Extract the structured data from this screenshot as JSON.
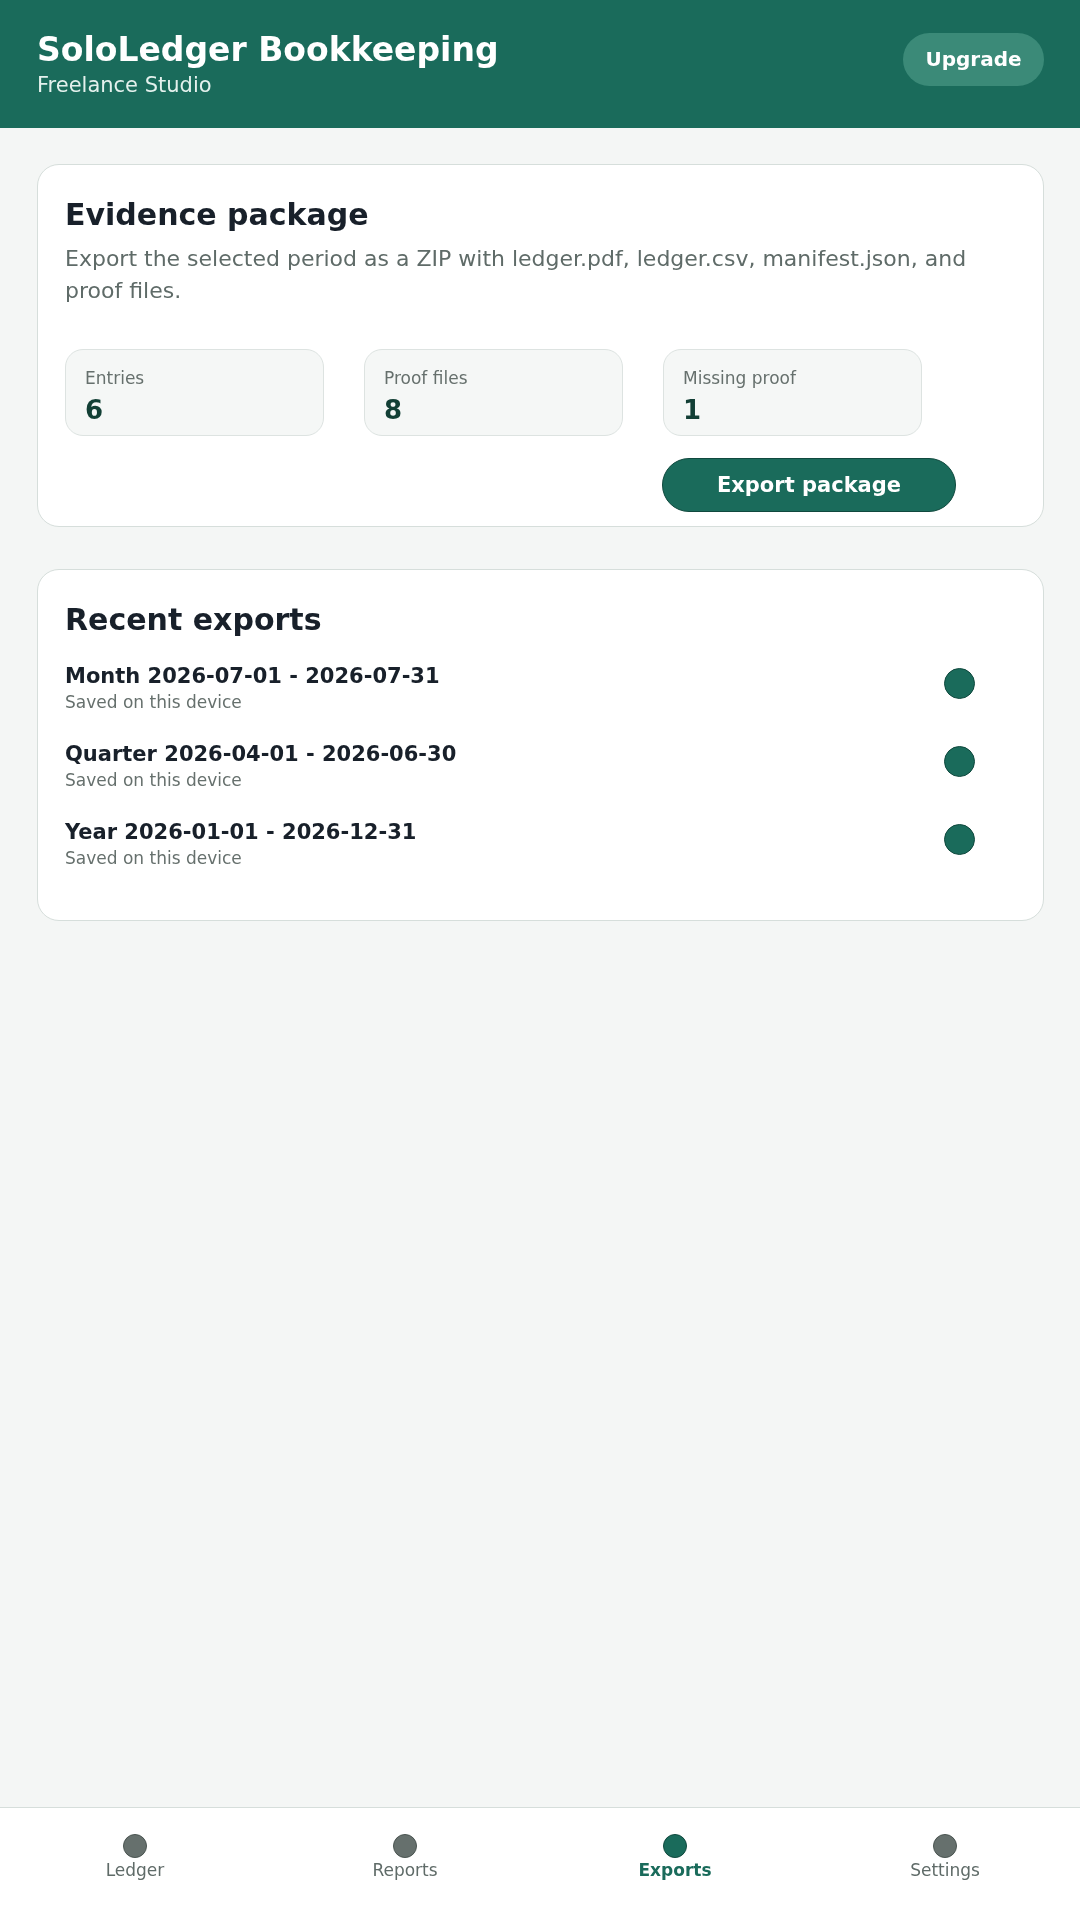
{
  "header": {
    "title": "SoloLedger Bookkeeping",
    "subtitle": "Freelance Studio",
    "upgrade_button": "Upgrade"
  },
  "evidence_package": {
    "title": "Evidence package",
    "description": "Export the selected period as a ZIP with ledger.pdf, ledger.csv, manifest.json, and proof files.",
    "stats": [
      {
        "label": "Entries",
        "value": "6"
      },
      {
        "label": "Proof files",
        "value": "8"
      },
      {
        "label": "Missing proof",
        "value": "1"
      }
    ],
    "export_button": "Export package"
  },
  "recent_exports": {
    "title": "Recent exports",
    "items": [
      {
        "title": "Month 2026-07-01 - 2026-07-31",
        "subtitle": "Saved on this device"
      },
      {
        "title": "Quarter 2026-04-01 - 2026-06-30",
        "subtitle": "Saved on this device"
      },
      {
        "title": "Year 2026-01-01 - 2026-12-31",
        "subtitle": "Saved on this device"
      }
    ]
  },
  "bottom_nav": [
    {
      "label": "Ledger",
      "selected": false
    },
    {
      "label": "Reports",
      "selected": false
    },
    {
      "label": "Exports",
      "selected": true
    },
    {
      "label": "Settings",
      "selected": false
    }
  ]
}
